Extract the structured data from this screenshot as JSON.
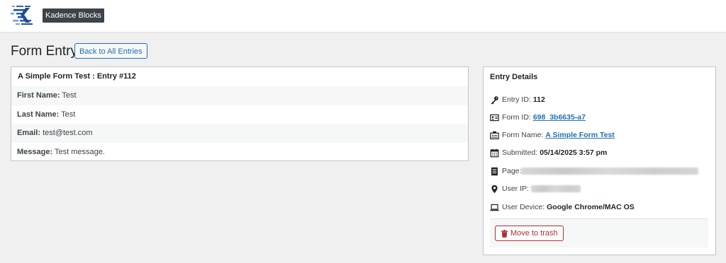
{
  "topbar": {
    "brand": "Kadence Blocks",
    "logo_icon": "kadence-logo-icon"
  },
  "header": {
    "title": "Form Entry",
    "back_button": "Back to All Entries"
  },
  "entry": {
    "title": "A Simple Form Test : Entry #112",
    "fields": [
      {
        "label": "First Name:",
        "value": "Test"
      },
      {
        "label": "Last Name:",
        "value": "Test"
      },
      {
        "label": "Email:",
        "value": "test@test.com"
      },
      {
        "label": "Message:",
        "value": "Test message."
      }
    ]
  },
  "details": {
    "title": "Entry Details",
    "entry_id": {
      "label": "Entry ID:",
      "value": "112",
      "icon": "key-icon"
    },
    "form_id": {
      "label": "Form ID:",
      "value": "698_3b6635-a7",
      "icon": "id-card-icon"
    },
    "form_name": {
      "label": "Form Name:",
      "value": "A Simple Form Test",
      "icon": "form-icon"
    },
    "submitted": {
      "label": "Submitted:",
      "value": "05/14/2025 3:57 pm",
      "icon": "calendar-icon"
    },
    "page": {
      "label": "Page:",
      "icon": "page-icon"
    },
    "user_ip": {
      "label": "User IP:",
      "icon": "location-pin-icon"
    },
    "user_device": {
      "label": "User Device:",
      "value": "Google Chrome/MAC OS",
      "icon": "laptop-icon"
    },
    "trash_button": "Move to trash"
  },
  "colors": {
    "accent": "#2271b1",
    "danger": "#b32d2e",
    "background": "#f0f0f1",
    "badge": "#3c4349"
  }
}
